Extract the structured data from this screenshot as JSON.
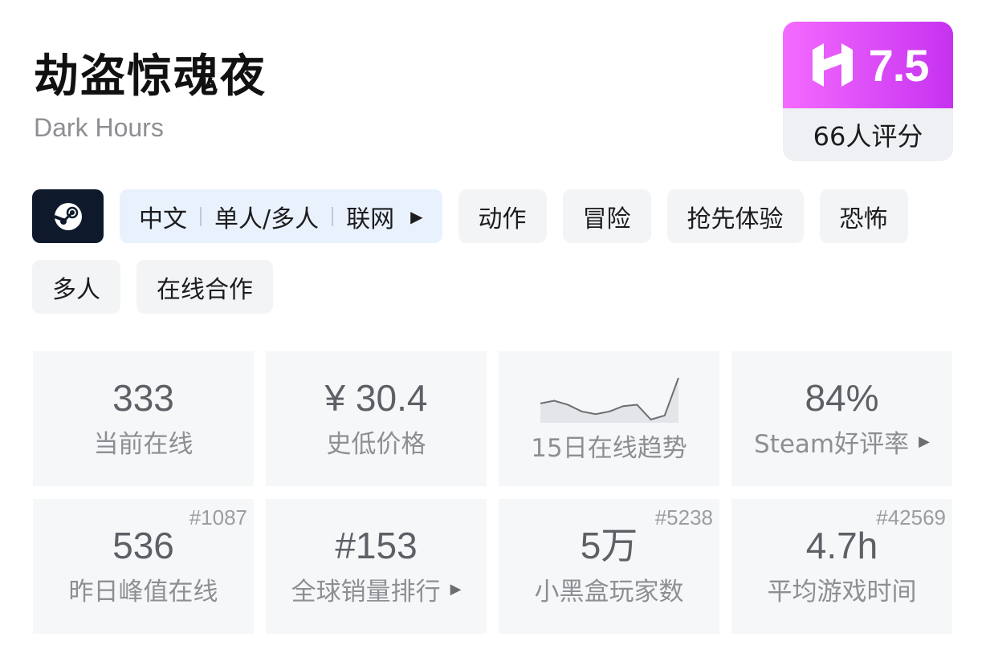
{
  "game": {
    "title": "劫盗惊魂夜",
    "subtitle": "Dark Hours"
  },
  "score": {
    "value": "7.5",
    "count_label": "66人评分",
    "gradient": [
      "#f46bff",
      "#c632f0"
    ]
  },
  "platform": {
    "icon": "steam-icon",
    "color": "#0e1a2b"
  },
  "info_tag": {
    "items": [
      "中文",
      "单人/多人",
      "联网"
    ],
    "arrow": "▶"
  },
  "tags": [
    "动作",
    "冒险",
    "抢先体验",
    "恐怖",
    "多人",
    "在线合作"
  ],
  "stats": [
    {
      "value": "333",
      "label": "当前在线",
      "rank": ""
    },
    {
      "value": "¥ 30.4",
      "label": "史低价格",
      "rank": ""
    },
    {
      "value": "",
      "label": "15日在线趋势",
      "rank": ""
    },
    {
      "value": "84%",
      "label": "Steam好评率",
      "rank": "",
      "caret": "▶"
    },
    {
      "value": "536",
      "label": "昨日峰值在线",
      "rank": "#1087"
    },
    {
      "value": "#153",
      "label": "全球销量排行",
      "rank": "",
      "caret": "▶"
    },
    {
      "value": "5万",
      "label": "小黑盒玩家数",
      "rank": "#5238"
    },
    {
      "value": "4.7h",
      "label": "平均游戏时间",
      "rank": "#42569"
    }
  ],
  "trend": {
    "values": [
      44,
      46,
      43,
      38,
      36,
      38,
      42,
      43,
      32,
      35,
      63
    ]
  }
}
